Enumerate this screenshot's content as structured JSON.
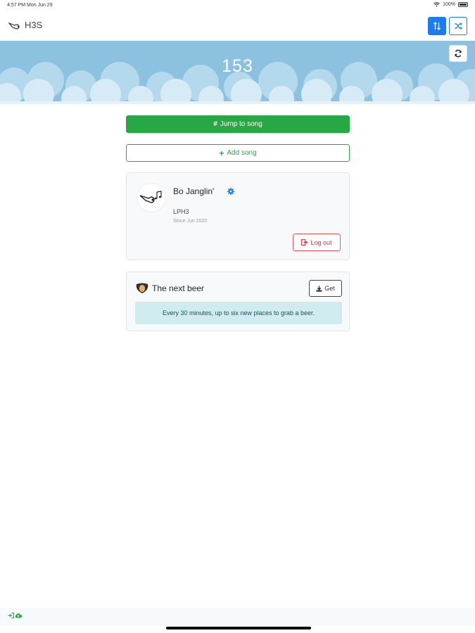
{
  "status_bar": {
    "time_date": "4:57 PM   Mon Jun 29",
    "battery_text": "100%"
  },
  "navbar": {
    "brand": "H3S",
    "brand_icon": "whistle-icon",
    "sort_icon": "sort-icon",
    "shuffle_icon": "shuffle-icon"
  },
  "hero": {
    "count": "153",
    "refresh_icon": "refresh-icon"
  },
  "actions": {
    "jump_label": "Jump to song",
    "jump_icon": "hash-icon",
    "add_label": "Add song",
    "add_icon": "plus-icon"
  },
  "profile": {
    "name": "Bo Janglin'",
    "kennel": "LPH3",
    "since": "Since Jun 2020",
    "logout_label": "Log out",
    "settings_icon": "gear-icon",
    "avatar_icon": "hasher-logo-icon"
  },
  "beer_card": {
    "title": "The next beer",
    "get_label": "Get",
    "info": "Every 30 minutes, up to six new places to grab a beer.",
    "title_icon": "beer-badge-icon"
  },
  "footer": {
    "icons": [
      "sign-in-icon",
      "cloud-upload-icon"
    ]
  },
  "colors": {
    "primary": "#1a7cf0",
    "success": "#28a745",
    "danger": "#dc3545",
    "info_bg": "#d1ecf1",
    "sky": "#8cc2e0"
  }
}
